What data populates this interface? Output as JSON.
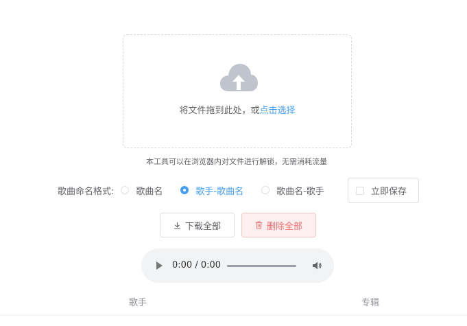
{
  "upload": {
    "hint_prefix": "将文件拖到此处，或",
    "hint_link": "点击选择",
    "icon": "upload-cloud-icon",
    "icon_color": "#c0c4cc"
  },
  "tip": "本工具可以在浏览器内对文件进行解锁，无需消耗流量",
  "naming": {
    "label": "歌曲命名格式:",
    "options": [
      "歌曲名",
      "歌手-歌曲名",
      "歌曲名-歌手"
    ],
    "selected": "歌手-歌曲名"
  },
  "save": {
    "label": "立即保存",
    "checked": false
  },
  "buttons": {
    "download_all": "下载全部",
    "delete_all": "删除全部"
  },
  "player": {
    "time": "0:00 / 0:00"
  },
  "table": {
    "columns": [
      "歌手",
      "专辑"
    ]
  },
  "colors": {
    "primary": "#409eff",
    "danger": "#f56c6c",
    "danger_bg": "#fef0f0"
  }
}
